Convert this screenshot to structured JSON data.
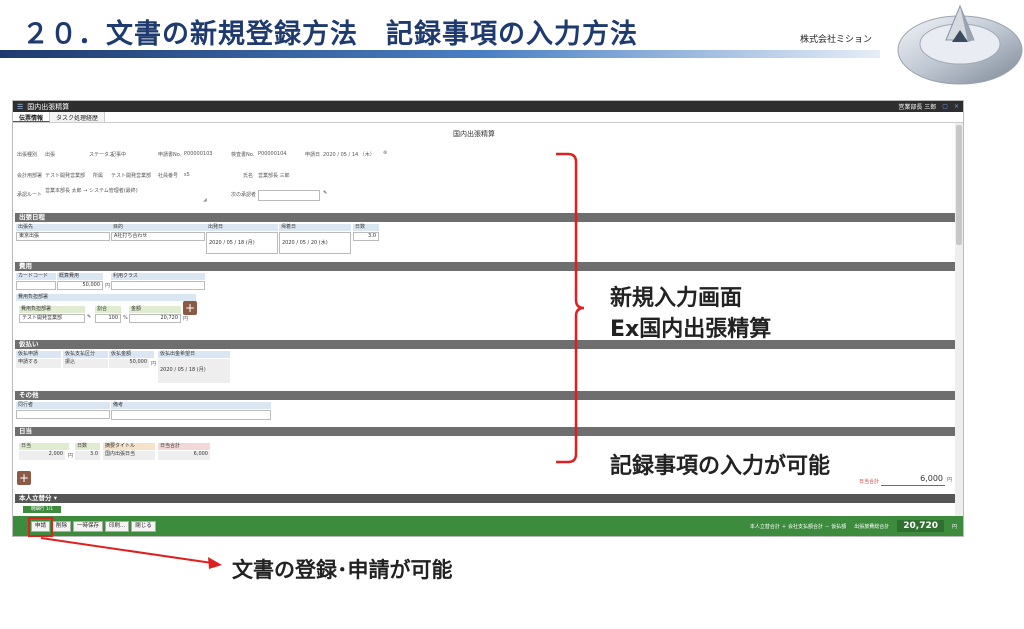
{
  "slide": {
    "title": "２０．文書の新規登録方法　記録事項の入力方法",
    "company": "株式会社ミション"
  },
  "app": {
    "window_title": "国内出張精算",
    "user": "営業部長 三郎",
    "tabs": [
      {
        "label": "伝票情報"
      },
      {
        "label": "タスク処理経歴"
      }
    ],
    "form_title": "国内出張精算",
    "header_fields": {
      "type_label": "出張種別",
      "type_value": "出張",
      "status_label": "ステータス",
      "status_value": "記事中",
      "appno_label": "申請書No.",
      "appno_value": "P00000103",
      "confno_label": "検査書No.",
      "confno_value": "P00000104",
      "date_label": "申請日",
      "date_value": "2020 / 05 / 14 （木）",
      "dept_label": "会計用部署",
      "dept_value": "テスト開発営業部",
      "belong_label": "所属",
      "belong_value": "テスト開発営業部",
      "empno_label": "社員番号",
      "empno_value": "s5",
      "name_label": "氏名",
      "name_value": "営業部長 三郎",
      "route_label": "承認ルート",
      "route_value": "営業本部長 太郎 → システム管理者(最終)",
      "next_label": "次の承認者",
      "next_value": ""
    },
    "sections": {
      "trip": "出張日程",
      "expense": "費用",
      "advance": "仮払い",
      "other": "その他",
      "daily": "日当",
      "reimburse": "本人立替分 ▾"
    },
    "trip": {
      "dest_label": "出張先",
      "dest_value": "東京出張",
      "purpose_label": "目的",
      "purpose_value": "A社打ち合わせ",
      "depart_label": "出発日",
      "depart_value": "2020 / 05 / 18 (月)",
      "return_label": "帰着日",
      "return_value": "2020 / 05 / 20 (水)",
      "days_label": "日数",
      "days_value": "3.0"
    },
    "expense": {
      "card_label": "カードコード",
      "card_value": "",
      "est_label": "概算費用",
      "est_value": "50,000",
      "est_unit": "円",
      "class_label": "利用クラス",
      "class_value": "",
      "burden_label": "費用負担部署",
      "burden_dept_label": "費用負担部署",
      "burden_dept_value": "テスト開発営業部",
      "ratio_label": "割合",
      "ratio_value": "100",
      "ratio_unit": "%",
      "amount_label": "金額",
      "amount_value": "20,720",
      "amount_unit": "円"
    },
    "advance": {
      "apply_label": "仮払申請",
      "apply_value": "申請する",
      "method_label": "仮払支払区分",
      "method_value": "振込",
      "amount_label": "仮払金額",
      "amount_value": "50,000",
      "amount_unit": "円",
      "date_label": "仮払出金希望日",
      "date_value": "2020 / 05 / 18 (月)"
    },
    "other": {
      "companion_label": "同行者",
      "companion_value": "",
      "remarks_label": "備考",
      "remarks_value": ""
    },
    "daily": {
      "amount_label": "日当",
      "amount_value": "2,000",
      "amount_unit": "円",
      "days_label": "日数",
      "days_value": "3.0",
      "title_label": "摘要タイトル",
      "title_value": "国内出張日当",
      "total_label": "日当合計",
      "total_value": "6,000",
      "subtotal_label": "日当合計",
      "subtotal_value": "6,000",
      "subtotal_unit": "円"
    },
    "detail_tab": "明細行 1/1",
    "buttons": [
      {
        "label": "申請"
      },
      {
        "label": "削除"
      },
      {
        "label": "一時保存"
      },
      {
        "label": "印刷..."
      },
      {
        "label": "閉じる"
      }
    ],
    "footer": {
      "calc": "本人立替合計 ＋ 会社支払額合計 － 仮払額",
      "total_label": "出張旅費総合計",
      "total_value": "20,720",
      "total_unit": "円"
    }
  },
  "annotations": {
    "screen_title_1": "新規入力画面",
    "screen_title_2": "Ex国内出張精算",
    "input_note": "記録事項の入力が可能",
    "submit_note": "文書の登録･申請が可能"
  },
  "colors": {
    "title": "#1f3a6e",
    "section": "#6e6e6e",
    "bottom_bar": "#3d8b3d",
    "annotation_red": "#e02020"
  }
}
